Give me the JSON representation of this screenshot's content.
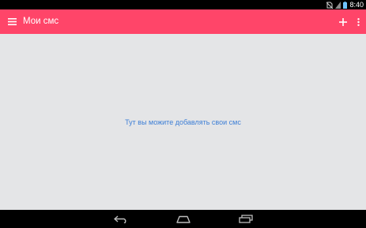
{
  "status_bar": {
    "time": "8:40",
    "icons": [
      "no-sim-icon",
      "signal-icon",
      "battery-icon"
    ]
  },
  "app_bar": {
    "title": "Мои смс",
    "background_color": "#ff4569",
    "icons": [
      "menu-icon",
      "add-icon",
      "more-vert-icon"
    ]
  },
  "main": {
    "empty_message": "Тут вы можите добавлять свои смс",
    "message_color": "#3e7fd6"
  },
  "nav_bar": {
    "icons": [
      "back-icon",
      "home-icon",
      "recents-icon"
    ]
  }
}
